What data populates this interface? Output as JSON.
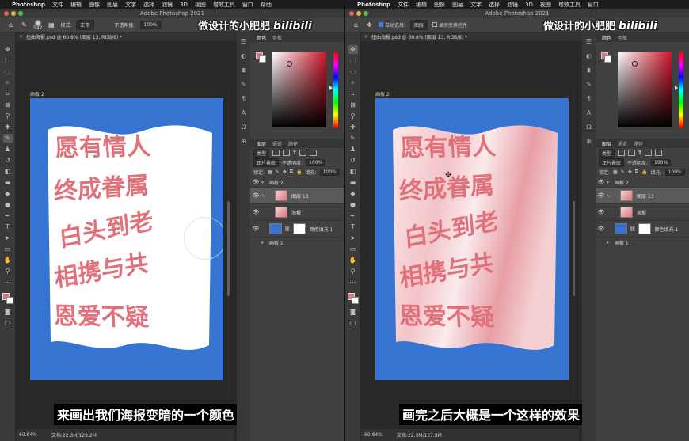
{
  "menubar": {
    "app": "Photoshop",
    "items": [
      "文件",
      "编辑",
      "图像",
      "图层",
      "文字",
      "选择",
      "滤镜",
      "3D",
      "视图",
      "增效工具",
      "窗口",
      "帮助"
    ]
  },
  "window_title": "Adobe Photoshop 2021",
  "watermark": {
    "text": "做设计的小肥肥",
    "logo": "bilibili"
  },
  "options_left": {
    "brush_size": "542",
    "mode_label": "模式:",
    "mode_value": "正常",
    "opacity_label": "不透明度:",
    "opacity_value": "100%"
  },
  "options_right": {
    "auto_select_label": "自动选择:",
    "auto_select_value": "图层",
    "transform_label": "显示变换控件"
  },
  "doc_tab": "扭曲海报.psd @ 60.8% (图层 13, RGB/8) *",
  "artboard_label": "画板 2",
  "poster_lines": [
    "愿有情人",
    "终成眷属",
    "白头到老",
    "相携与共",
    "恩爱不疑"
  ],
  "subtitles": {
    "left": "来画出我们海报变暗的一个颜色",
    "right": "画完之后大概是一个这样的效果"
  },
  "status": {
    "zoom": "60.84%",
    "doc_left": "文档:22.3M/129.2M",
    "doc_right": "文档:22.3M/137.8M"
  },
  "color_panel": {
    "tabs": [
      "颜色",
      "色板"
    ]
  },
  "layers_panel": {
    "tabs": [
      "图层",
      "通道",
      "路径"
    ],
    "filter_label": "类型",
    "blend_mode": "正片叠底",
    "opacity_label": "不透明度:",
    "opacity_value": "100%",
    "lock_label": "锁定:",
    "fill_label": "填充:",
    "fill_value": "100%",
    "layers": [
      {
        "name": "画板 2",
        "kind": "group"
      },
      {
        "name": "图层 13",
        "kind": "layer"
      },
      {
        "name": "海报",
        "kind": "layer"
      },
      {
        "name": "颜色填充 1",
        "kind": "fill"
      },
      {
        "name": "画板 1",
        "kind": "group"
      }
    ]
  },
  "colors": {
    "artboard_blue": "#3574d1",
    "text_pink": "#e0707a",
    "foreground": "#dd7880"
  }
}
